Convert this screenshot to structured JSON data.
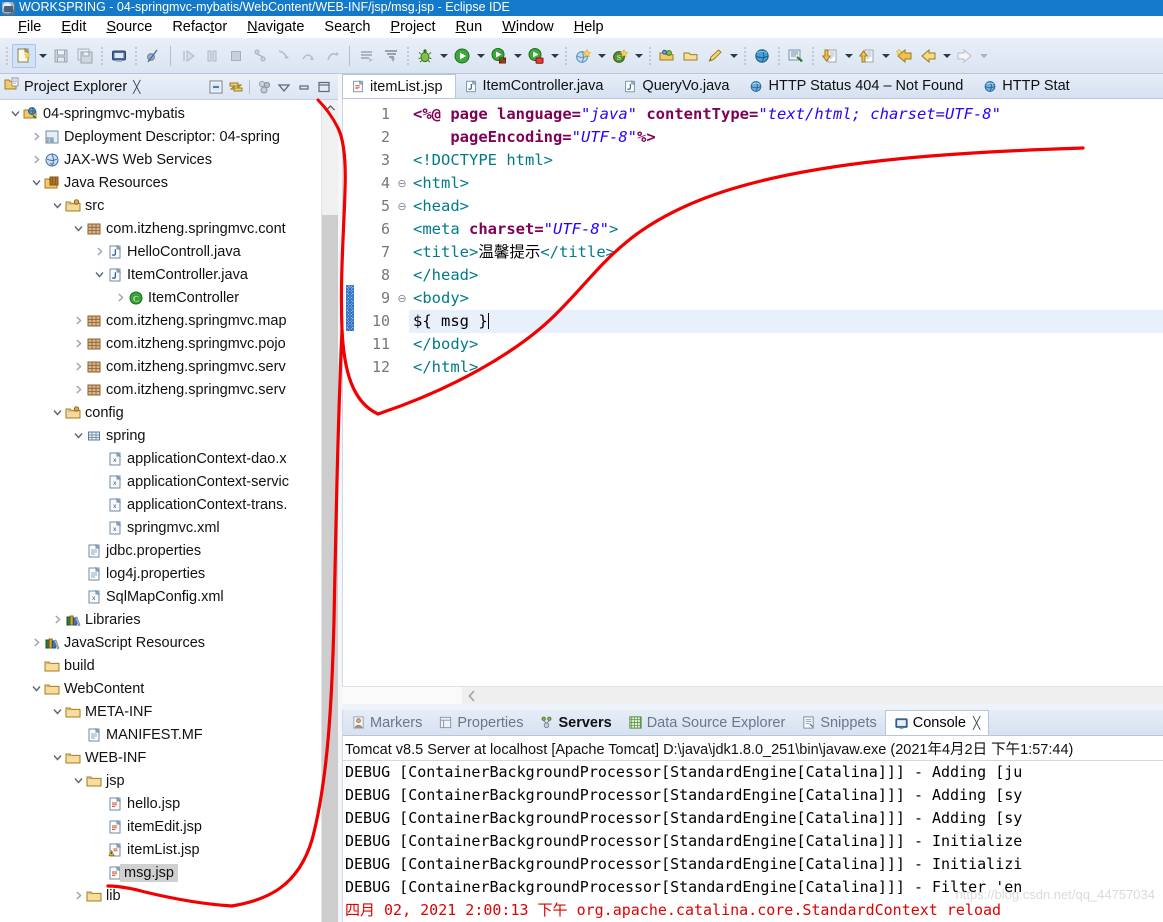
{
  "window": {
    "title": "WORKSPRING - 04-springmvc-mybatis/WebContent/WEB-INF/jsp/msg.jsp - Eclipse IDE",
    "app_icon": "eclipse-icon"
  },
  "menubar": {
    "items": [
      {
        "label": "File",
        "mnemonic": "F"
      },
      {
        "label": "Edit",
        "mnemonic": "E"
      },
      {
        "label": "Source",
        "mnemonic": "S"
      },
      {
        "label": "Refactor",
        "mnemonic": "t"
      },
      {
        "label": "Navigate",
        "mnemonic": "N"
      },
      {
        "label": "Search",
        "mnemonic": "r"
      },
      {
        "label": "Project",
        "mnemonic": "P"
      },
      {
        "label": "Run",
        "mnemonic": "R"
      },
      {
        "label": "Window",
        "mnemonic": "W"
      },
      {
        "label": "Help",
        "mnemonic": "H"
      }
    ]
  },
  "toolbar": {
    "buttons": [
      {
        "name": "new-button",
        "icon": "new-file-icon"
      },
      {
        "name": "save-button",
        "icon": "save-icon"
      },
      {
        "name": "save-all-button",
        "icon": "save-all-icon"
      },
      {
        "name": "print-button",
        "icon": "print-icon"
      },
      {
        "name": "toggle-breakpoint-button",
        "icon": "skip-breakpoints-icon"
      },
      {
        "name": "resume-button",
        "icon": "resume-icon"
      },
      {
        "name": "suspend-button",
        "icon": "suspend-icon"
      },
      {
        "name": "terminate-button",
        "icon": "terminate-icon"
      },
      {
        "name": "disconnect-button",
        "icon": "disconnect-icon"
      },
      {
        "name": "step-into-button",
        "icon": "step-into-icon"
      },
      {
        "name": "step-over-button",
        "icon": "step-over-icon"
      },
      {
        "name": "step-return-button",
        "icon": "step-return-icon"
      },
      {
        "name": "next-annotation-button",
        "icon": "next-annotation-icon"
      },
      {
        "name": "previous-annotation-button",
        "icon": "previous-annotation-icon"
      },
      {
        "name": "debug-button",
        "icon": "debug-bug-icon"
      },
      {
        "name": "run-button",
        "icon": "run-green-play-icon"
      },
      {
        "name": "run-server-button",
        "icon": "run-on-server-icon"
      },
      {
        "name": "profile-button",
        "icon": "profile-icon"
      },
      {
        "name": "new-java-project-button",
        "icon": "new-java-project-icon"
      },
      {
        "name": "new-spring-button",
        "icon": "new-spring-icon"
      },
      {
        "name": "open-type-button",
        "icon": "open-type-icon"
      },
      {
        "name": "open-task-button",
        "icon": "open-task-icon"
      },
      {
        "name": "new-task-button",
        "icon": "new-task-icon"
      },
      {
        "name": "web-browser-button",
        "icon": "globe-icon"
      },
      {
        "name": "search-button",
        "icon": "search-icon"
      },
      {
        "name": "previous-edit-button",
        "icon": "down-arrow-doc-icon"
      },
      {
        "name": "next-edit-button",
        "icon": "up-arrow-doc-icon"
      },
      {
        "name": "back-to-last-edit-button",
        "icon": "last-edit-location-icon"
      },
      {
        "name": "back-button",
        "icon": "back-arrow-icon"
      },
      {
        "name": "forward-button",
        "icon": "forward-arrow-icon"
      }
    ]
  },
  "explorer": {
    "title": "Project Explorer",
    "close_glyph": "╳",
    "tools": [
      {
        "name": "collapse-all-button",
        "icon": "collapse-all-icon"
      },
      {
        "name": "link-with-editor-button",
        "icon": "link-editor-icon"
      },
      {
        "name": "working-sets-button",
        "icon": "working-sets-icon"
      },
      {
        "name": "view-menu-button",
        "icon": "chevron-down-icon"
      },
      {
        "name": "minimize-button",
        "icon": "minimize-icon"
      },
      {
        "name": "maximize-button",
        "icon": "maximize-icon"
      }
    ],
    "tree": [
      {
        "label": "04-springmvc-mybatis",
        "indent": 0,
        "twist": "open",
        "icon": "web-project-icon"
      },
      {
        "label": "Deployment Descriptor: 04-spring",
        "indent": 1,
        "twist": "closed",
        "icon": "deployment-descriptor-icon"
      },
      {
        "label": "JAX-WS Web Services",
        "indent": 1,
        "twist": "closed",
        "icon": "jaxws-icon"
      },
      {
        "label": "Java Resources",
        "indent": 1,
        "twist": "open",
        "icon": "java-resources-icon"
      },
      {
        "label": "src",
        "indent": 2,
        "twist": "open",
        "icon": "source-folder-icon"
      },
      {
        "label": "com.itzheng.springmvc.cont",
        "indent": 3,
        "twist": "open",
        "icon": "package-icon"
      },
      {
        "label": "HelloControll.java",
        "indent": 4,
        "twist": "closed",
        "icon": "java-file-icon"
      },
      {
        "label": "ItemController.java",
        "indent": 4,
        "twist": "open",
        "icon": "java-file-icon"
      },
      {
        "label": "ItemController",
        "indent": 5,
        "twist": "closed",
        "icon": "class-icon"
      },
      {
        "label": "com.itzheng.springmvc.map",
        "indent": 3,
        "twist": "closed",
        "icon": "package-icon"
      },
      {
        "label": "com.itzheng.springmvc.pojo",
        "indent": 3,
        "twist": "closed",
        "icon": "package-icon"
      },
      {
        "label": "com.itzheng.springmvc.serv",
        "indent": 3,
        "twist": "closed",
        "icon": "package-icon"
      },
      {
        "label": "com.itzheng.springmvc.serv",
        "indent": 3,
        "twist": "closed",
        "icon": "package-icon"
      },
      {
        "label": "config",
        "indent": 2,
        "twist": "open",
        "icon": "source-folder-icon"
      },
      {
        "label": "spring",
        "indent": 3,
        "twist": "open",
        "icon": "package-folder-icon"
      },
      {
        "label": "applicationContext-dao.x",
        "indent": 4,
        "twist": "none",
        "icon": "xml-file-icon"
      },
      {
        "label": "applicationContext-servic",
        "indent": 4,
        "twist": "none",
        "icon": "xml-file-icon"
      },
      {
        "label": "applicationContext-trans.",
        "indent": 4,
        "twist": "none",
        "icon": "xml-file-icon"
      },
      {
        "label": "springmvc.xml",
        "indent": 4,
        "twist": "none",
        "icon": "xml-file-icon"
      },
      {
        "label": "jdbc.properties",
        "indent": 3,
        "twist": "none",
        "icon": "properties-file-icon"
      },
      {
        "label": "log4j.properties",
        "indent": 3,
        "twist": "none",
        "icon": "properties-file-icon"
      },
      {
        "label": "SqlMapConfig.xml",
        "indent": 3,
        "twist": "none",
        "icon": "xml-file-icon"
      },
      {
        "label": "Libraries",
        "indent": 2,
        "twist": "closed",
        "icon": "libraries-icon"
      },
      {
        "label": "JavaScript Resources",
        "indent": 1,
        "twist": "closed",
        "icon": "libraries-icon"
      },
      {
        "label": "build",
        "indent": 1,
        "twist": "none",
        "icon": "folder-icon"
      },
      {
        "label": "WebContent",
        "indent": 1,
        "twist": "open",
        "icon": "folder-icon"
      },
      {
        "label": "META-INF",
        "indent": 2,
        "twist": "open",
        "icon": "folder-icon"
      },
      {
        "label": "MANIFEST.MF",
        "indent": 3,
        "twist": "none",
        "icon": "manifest-file-icon"
      },
      {
        "label": "WEB-INF",
        "indent": 2,
        "twist": "open",
        "icon": "folder-icon"
      },
      {
        "label": "jsp",
        "indent": 3,
        "twist": "open",
        "icon": "folder-icon"
      },
      {
        "label": "hello.jsp",
        "indent": 4,
        "twist": "none",
        "icon": "jsp-file-icon"
      },
      {
        "label": "itemEdit.jsp",
        "indent": 4,
        "twist": "none",
        "icon": "jsp-file-icon"
      },
      {
        "label": "itemList.jsp",
        "indent": 4,
        "twist": "none",
        "icon": "jsp-file-warning-icon"
      },
      {
        "label": "msg.jsp",
        "indent": 4,
        "twist": "none",
        "icon": "jsp-file-icon",
        "selected": true
      },
      {
        "label": "lib",
        "indent": 3,
        "twist": "closed",
        "icon": "folder-icon"
      }
    ]
  },
  "editor": {
    "tabs": [
      {
        "label": "itemList.jsp",
        "icon": "jsp-file-icon",
        "active": true
      },
      {
        "label": "ItemController.java",
        "icon": "java-file-icon",
        "active": false
      },
      {
        "label": "QueryVo.java",
        "icon": "java-file-icon",
        "active": false
      },
      {
        "label": "HTTP Status 404 – Not Found",
        "icon": "globe-icon",
        "active": false
      },
      {
        "label": "HTTP Stat",
        "icon": "globe-icon",
        "active": false
      }
    ],
    "lines": [
      {
        "no": "1",
        "fold": "",
        "current": false,
        "tokens": [
          {
            "t": "<%@ ",
            "c": "tk-dir"
          },
          {
            "t": "page ",
            "c": "tk-dir"
          },
          {
            "t": "language=",
            "c": "tk-attr"
          },
          {
            "t": "\"java\"",
            "c": "tk-str"
          },
          {
            "t": " ",
            "c": "tk-txt"
          },
          {
            "t": "contentType=",
            "c": "tk-attr"
          },
          {
            "t": "\"text/html; charset=UTF-8\"",
            "c": "tk-str"
          }
        ]
      },
      {
        "no": "2",
        "fold": "",
        "current": false,
        "tokens": [
          {
            "t": "    ",
            "c": "tk-txt"
          },
          {
            "t": "pageEncoding=",
            "c": "tk-attr"
          },
          {
            "t": "\"UTF-8\"",
            "c": "tk-str"
          },
          {
            "t": "%>",
            "c": "tk-dir"
          }
        ]
      },
      {
        "no": "3",
        "fold": "",
        "current": false,
        "tokens": [
          {
            "t": "<!DOCTYPE html>",
            "c": "tk-doctype"
          }
        ]
      },
      {
        "no": "4",
        "fold": "⊖",
        "current": false,
        "tokens": [
          {
            "t": "<html>",
            "c": "tk-tag"
          }
        ]
      },
      {
        "no": "5",
        "fold": "⊖",
        "current": false,
        "tokens": [
          {
            "t": "<head>",
            "c": "tk-tag"
          }
        ]
      },
      {
        "no": "6",
        "fold": "",
        "current": false,
        "tokens": [
          {
            "t": "<meta ",
            "c": "tk-tag"
          },
          {
            "t": "charset=",
            "c": "tk-attr"
          },
          {
            "t": "\"UTF-8\"",
            "c": "tk-str"
          },
          {
            "t": ">",
            "c": "tk-tag"
          }
        ]
      },
      {
        "no": "7",
        "fold": "",
        "current": false,
        "tokens": [
          {
            "t": "<title>",
            "c": "tk-tag"
          },
          {
            "t": "温馨提示",
            "c": "tk-txt"
          },
          {
            "t": "</title>",
            "c": "tk-tag"
          }
        ]
      },
      {
        "no": "8",
        "fold": "",
        "current": false,
        "tokens": [
          {
            "t": "</head>",
            "c": "tk-tag"
          }
        ]
      },
      {
        "no": "9",
        "fold": "⊖",
        "current": false,
        "tokens": [
          {
            "t": "<body>",
            "c": "tk-tag"
          }
        ]
      },
      {
        "no": "10",
        "fold": "",
        "current": true,
        "tokens": [
          {
            "t": "${ msg }",
            "c": "tk-txt"
          }
        ]
      },
      {
        "no": "11",
        "fold": "",
        "current": false,
        "tokens": [
          {
            "t": "</body>",
            "c": "tk-tag"
          }
        ]
      },
      {
        "no": "12",
        "fold": "",
        "current": false,
        "tokens": [
          {
            "t": "</html>",
            "c": "tk-tag"
          }
        ]
      }
    ]
  },
  "bottom_panel": {
    "tabs": [
      {
        "label": "Markers",
        "icon": "markers-icon",
        "state": "normal"
      },
      {
        "label": "Properties",
        "icon": "properties-icon",
        "state": "normal"
      },
      {
        "label": "Servers",
        "icon": "servers-icon",
        "state": "bold"
      },
      {
        "label": "Data Source Explorer",
        "icon": "data-source-icon",
        "state": "normal"
      },
      {
        "label": "Snippets",
        "icon": "snippets-icon",
        "state": "normal"
      },
      {
        "label": "Console",
        "icon": "console-icon",
        "state": "active"
      }
    ],
    "console": {
      "header": "Tomcat v8.5 Server at localhost [Apache Tomcat] D:\\java\\jdk1.8.0_251\\bin\\javaw.exe (2021年4月2日 下午1:57:44)",
      "lines": [
        {
          "text": "DEBUG [ContainerBackgroundProcessor[StandardEngine[Catalina]]] - Adding [ju",
          "error": false
        },
        {
          "text": "DEBUG [ContainerBackgroundProcessor[StandardEngine[Catalina]]] - Adding [sy",
          "error": false
        },
        {
          "text": "DEBUG [ContainerBackgroundProcessor[StandardEngine[Catalina]]] - Adding [sy",
          "error": false
        },
        {
          "text": "DEBUG [ContainerBackgroundProcessor[StandardEngine[Catalina]]] - Initialize",
          "error": false
        },
        {
          "text": "DEBUG [ContainerBackgroundProcessor[StandardEngine[Catalina]]] - Initializi",
          "error": false
        },
        {
          "text": "DEBUG [ContainerBackgroundProcessor[StandardEngine[Catalina]]] - Filter 'en",
          "error": false
        },
        {
          "text": "四月 02, 2021 2:00:13 下午 org.apache.catalina.core.StandardContext reload",
          "error": true
        }
      ],
      "watermark": "https://blog.csdn.net/qq_44757034"
    }
  },
  "annotation": {
    "color": "#f00000",
    "description": "hand-drawn red line connecting msg.jsp in tree to editor code"
  }
}
